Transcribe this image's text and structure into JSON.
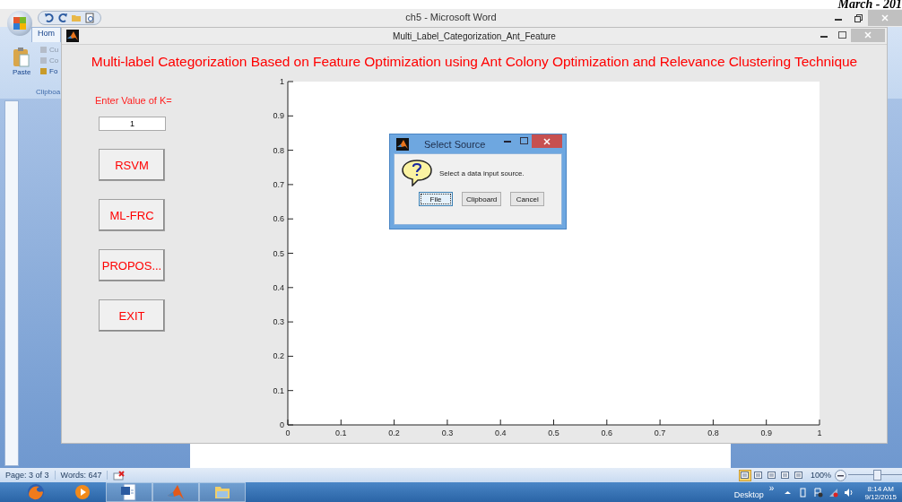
{
  "header_text": "March - 201",
  "word": {
    "title": "ch5 - Microsoft Word",
    "tab": "Hom",
    "ribbon": {
      "paste": "Paste",
      "items": [
        "Cu",
        "Co",
        "Fo"
      ],
      "group": "Clipboa"
    },
    "status": {
      "page": "Page: 3 of 3",
      "words": "Words: 647",
      "views": [
        {
          "selected": true
        },
        {
          "selected": false
        },
        {
          "selected": false
        },
        {
          "selected": false
        },
        {
          "selected": false
        }
      ],
      "zoom": "100%",
      "level": 0.45
    }
  },
  "figure": {
    "title": "Multi_Label_Categorization_Ant_Feature",
    "heading": "Multi-label Categorization Based on Feature Optimization using Ant Colony Optimization and Relevance Clustering Technique",
    "k_label": "Enter Value of K=",
    "k_value": "1",
    "buttons": [
      "RSVM",
      "ML-FRC",
      "PROPOS...",
      "EXIT"
    ],
    "chart_data": {
      "type": "line",
      "xlim": [
        0,
        1
      ],
      "ylim": [
        0,
        1
      ],
      "xticks": [
        {
          "value": 0,
          "label": "0"
        },
        {
          "value": 0.1,
          "label": "0.1"
        },
        {
          "value": 0.2,
          "label": "0.2"
        },
        {
          "value": 0.3,
          "label": "0.3"
        },
        {
          "value": 0.4,
          "label": "0.4"
        },
        {
          "value": 0.5,
          "label": "0.5"
        },
        {
          "value": 0.6,
          "label": "0.6"
        },
        {
          "value": 0.7,
          "label": "0.7"
        },
        {
          "value": 0.8,
          "label": "0.8"
        },
        {
          "value": 0.9,
          "label": "0.9"
        },
        {
          "value": 1,
          "label": "1"
        }
      ],
      "yticks": [
        {
          "value": 0,
          "label": "0"
        },
        {
          "value": 0.1,
          "label": "0.1"
        },
        {
          "value": 0.2,
          "label": "0.2"
        },
        {
          "value": 0.3,
          "label": "0.3"
        },
        {
          "value": 0.4,
          "label": "0.4"
        },
        {
          "value": 0.5,
          "label": "0.5"
        },
        {
          "value": 0.6,
          "label": "0.6"
        },
        {
          "value": 0.7,
          "label": "0.7"
        },
        {
          "value": 0.8,
          "label": "0.8"
        },
        {
          "value": 0.9,
          "label": "0.9"
        },
        {
          "value": 1,
          "label": "1"
        }
      ]
    }
  },
  "dialog": {
    "title": "Select Source",
    "message": "Select a data input source.",
    "buttons": [
      {
        "label": "File",
        "selected": true
      },
      {
        "label": "Clipboard",
        "selected": false
      },
      {
        "label": "Cancel",
        "selected": false
      }
    ]
  },
  "taskbar": {
    "desktop": "Desktop",
    "chevron": "»",
    "time": "8:14 AM",
    "date": "9/12/2015"
  }
}
